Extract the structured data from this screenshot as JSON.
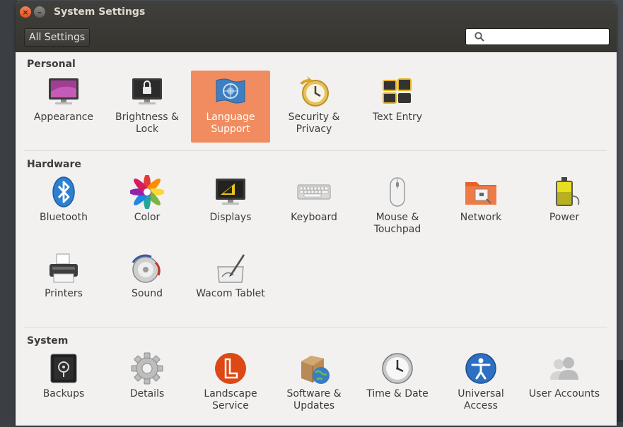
{
  "window": {
    "title": "System Settings"
  },
  "toolbar": {
    "all_settings_label": "All Settings"
  },
  "search": {
    "placeholder": "",
    "value": ""
  },
  "sections": [
    {
      "title": "Personal"
    },
    {
      "title": "Hardware"
    },
    {
      "title": "System"
    }
  ],
  "personal": [
    {
      "label": "Appearance",
      "icon": "monitor-purple-icon"
    },
    {
      "label": "Brightness &\nLock",
      "icon": "monitor-lock-icon"
    },
    {
      "label": "Language\nSupport",
      "icon": "language-flag-icon",
      "selected": true
    },
    {
      "label": "Security &\nPrivacy",
      "icon": "security-clock-icon"
    },
    {
      "label": "Text Entry",
      "icon": "keys-icon"
    }
  ],
  "hardware": [
    {
      "label": "Bluetooth",
      "icon": "bluetooth-icon"
    },
    {
      "label": "Color",
      "icon": "color-wheel-icon"
    },
    {
      "label": "Displays",
      "icon": "display-icon"
    },
    {
      "label": "Keyboard",
      "icon": "keyboard-icon"
    },
    {
      "label": "Mouse &\nTouchpad",
      "icon": "mouse-icon"
    },
    {
      "label": "Network",
      "icon": "network-folder-icon"
    },
    {
      "label": "Power",
      "icon": "battery-icon"
    },
    {
      "label": "Printers",
      "icon": "printer-icon"
    },
    {
      "label": "Sound",
      "icon": "speaker-icon"
    },
    {
      "label": "Wacom Tablet",
      "icon": "tablet-pen-icon"
    }
  ],
  "system": [
    {
      "label": "Backups",
      "icon": "safe-icon"
    },
    {
      "label": "Details",
      "icon": "gear-icon"
    },
    {
      "label": "Landscape\nService",
      "icon": "landscape-logo-icon"
    },
    {
      "label": "Software &\nUpdates",
      "icon": "package-globe-icon"
    },
    {
      "label": "Time & Date",
      "icon": "clock-icon"
    },
    {
      "label": "Universal\nAccess",
      "icon": "accessibility-icon"
    },
    {
      "label": "User Accounts",
      "icon": "users-icon"
    }
  ],
  "colors": {
    "selected": "#f08c5f",
    "titlebar": "#3c3b37",
    "accent": "#e2531f"
  }
}
